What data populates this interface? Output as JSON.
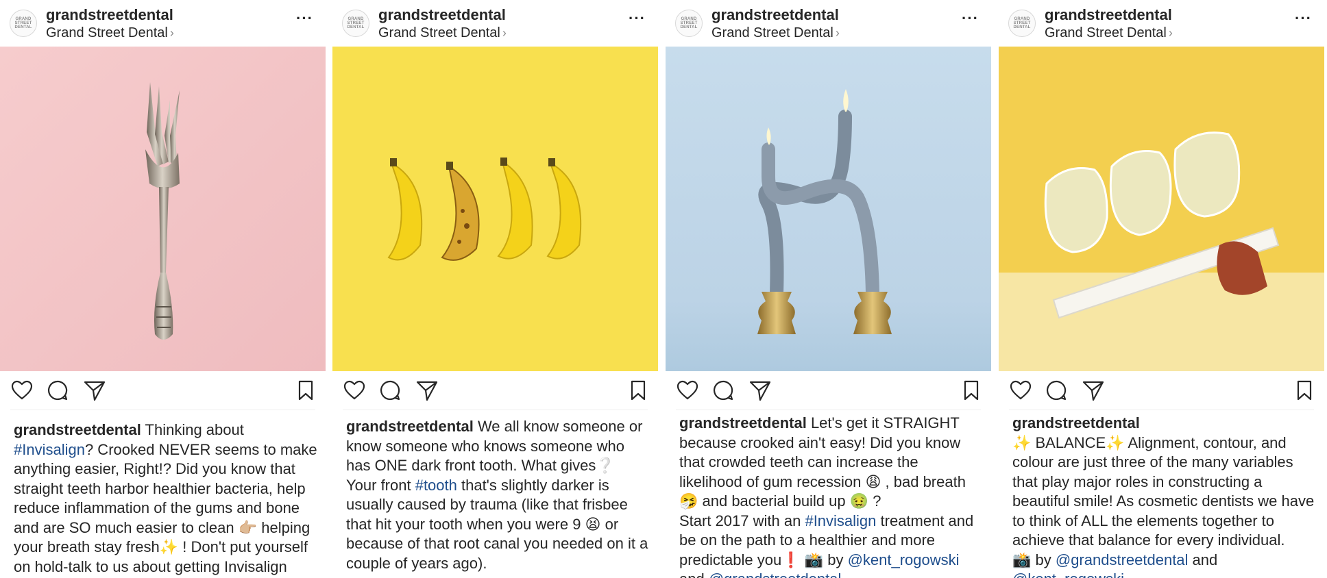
{
  "posts": [
    {
      "username": "grandstreetdental",
      "location": "Grand Street Dental",
      "avatar_text": "GRAND STREET DENTAL",
      "photo": "bent-fork-on-pink",
      "caption": {
        "user": "grandstreetdental",
        "t1": " Thinking about ",
        "h1": "#Invisalign",
        "t2": "? Crooked NEVER seems to make anything easier, Right!? Did you know that straight teeth harbor healthier bacteria, help reduce inflammation of the gums and bone and are SO much easier to clean 👉🏼 helping your breath stay fresh✨ ! Don't put yourself on hold-talk to us about getting Invisalign started...it really couldn't"
      }
    },
    {
      "username": "grandstreetdental",
      "location": "Grand Street Dental",
      "avatar_text": "GRAND STREET DENTAL",
      "photo": "four-bananas-on-yellow",
      "caption": {
        "user": "grandstreetdental",
        "t1": " We all know someone or know someone who knows someone who has ONE dark front tooth. What gives❔",
        "t2": "Your front ",
        "h1": "#tooth",
        "t3": " that's slightly darker is usually caused by trauma (like that frisbee that hit your tooth when you were 9 😫 or because of that root canal you needed on it a couple of years ago)."
      }
    },
    {
      "username": "grandstreetdental",
      "location": "Grand Street Dental",
      "avatar_text": "GRAND STREET DENTAL",
      "photo": "crossed-candles-on-blue",
      "caption": {
        "user": "grandstreetdental",
        "t1": " Let's get it STRAIGHT because crooked ain't easy! Did you know that crowded teeth can increase the likelihood of gum recession 😩 , bad breath 🤧 and bacterial build up 🤢 ?",
        "t2": "Start 2017 with an ",
        "h1": "#Invisalign",
        "t3": " treatment and be on the path to a healthier and more predictable you❗️  📸  by ",
        "h2": "@kent_rogowski",
        "t4": " and ",
        "h3": "@grandstreetdental"
      }
    },
    {
      "username": "grandstreetdental",
      "location": "Grand Street Dental",
      "avatar_text": "GRAND STREET DENTAL",
      "photo": "glasses-balanced-on-yellow",
      "caption": {
        "user": "grandstreetdental",
        "t1": "✨ BALANCE✨ Alignment, contour, and colour are just three of the many variables that play major roles in constructing a beautiful smile! As cosmetic dentists we have to think of ALL the elements together to achieve that balance for every individual.",
        "t2": "📸  by ",
        "h1": "@grandstreetdental",
        "t3": " and",
        "h2": "@kent_rogowski"
      }
    }
  ],
  "icons": [
    "heart-icon",
    "comment-icon",
    "share-icon",
    "bookmark-icon",
    "more-icon"
  ],
  "colors": {
    "hashtag": "#1f4e8c",
    "text": "#262626",
    "pink": "#f3c4c6",
    "yellow": "#f9e35a",
    "blue": "#c6dced",
    "gold": "#f4d45c"
  },
  "more_glyph": "···",
  "chevron": "›"
}
